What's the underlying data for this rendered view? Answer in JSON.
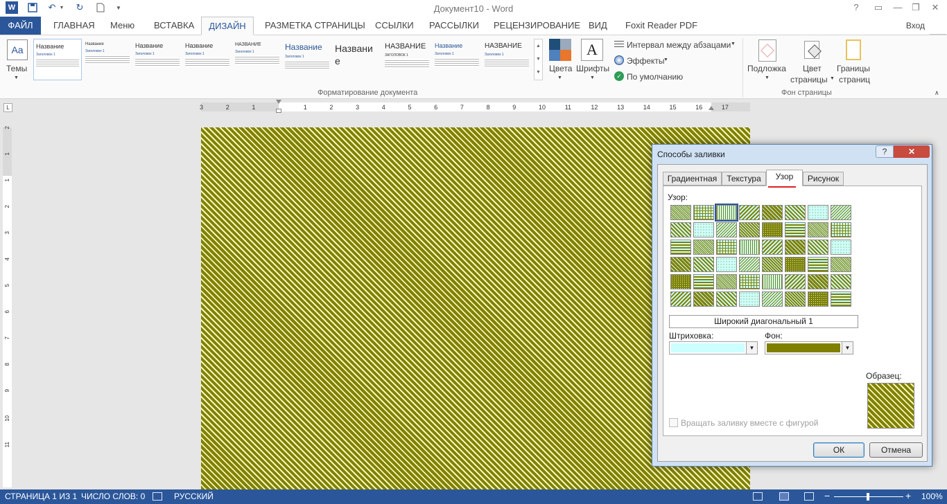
{
  "titlebar": {
    "title": "Документ10 - Word",
    "help": "?",
    "minimize": "—",
    "restore": "❐",
    "close": "✕"
  },
  "tabs": [
    {
      "label": "ФАЙЛ"
    },
    {
      "label": "ГЛАВНАЯ"
    },
    {
      "label": "Меню"
    },
    {
      "label": "ВСТАВКА"
    },
    {
      "label": "ДИЗАЙН"
    },
    {
      "label": "РАЗМЕТКА СТРАНИЦЫ"
    },
    {
      "label": "ССЫЛКИ"
    },
    {
      "label": "РАССЫЛКИ"
    },
    {
      "label": "РЕЦЕНЗИРОВАНИЕ"
    },
    {
      "label": "ВИД"
    },
    {
      "label": "Foxit Reader PDF"
    }
  ],
  "signin": "Вход",
  "ribbon": {
    "themes_label": "Темы",
    "themes_icon_text": "Aa",
    "gallery": [
      {
        "title": "Название",
        "sub": "Заголовок 1"
      },
      {
        "title": "Название",
        "sub": "Заголовок 1"
      },
      {
        "title": "Название",
        "sub": "Заголовок 1"
      },
      {
        "title": "Название",
        "sub": "Заголовок 1"
      },
      {
        "title": "НАЗВАНИЕ",
        "sub": "Заголовок 1"
      },
      {
        "title": "Название",
        "sub": "Заголовок 1"
      },
      {
        "title": "Названи е",
        "sub": ""
      },
      {
        "title": "НАЗВАНИЕ",
        "sub": "ЗАГОЛОВОК 1"
      },
      {
        "title": "Название",
        "sub": "Заголовок 1"
      },
      {
        "title": "НАЗВАНИЕ",
        "sub": "Заголовок 1"
      }
    ],
    "group_format_label": "Форматирование документа",
    "colors_label": "Цвета",
    "fonts_label": "Шрифты",
    "fonts_icon_text": "A",
    "paragraph_spacing_label": "Интервал между абзацами",
    "effects_label": "Эффекты",
    "default_label": "По умолчанию",
    "watermark_label": "Подложка",
    "page_color_label_1": "Цвет",
    "page_color_label_2": "страницы",
    "page_borders_label_1": "Границы",
    "page_borders_label_2": "страниц",
    "group_background_label": "Фон страницы"
  },
  "ruler": {
    "ticks": [
      "3",
      "2",
      "1",
      "1",
      "2",
      "3",
      "4",
      "5",
      "6",
      "7",
      "8",
      "9",
      "10",
      "11",
      "12",
      "13",
      "14",
      "15",
      "16",
      "17"
    ],
    "vticks": [
      "2",
      "1",
      "1",
      "2",
      "3",
      "4",
      "5",
      "6",
      "7",
      "8",
      "9",
      "10",
      "11"
    ]
  },
  "dialog": {
    "title": "Способы заливки",
    "help": "?",
    "close": "✕",
    "tabs": [
      {
        "label": "Градиентная"
      },
      {
        "label": "Текстура"
      },
      {
        "label": "Узор"
      },
      {
        "label": "Рисунок"
      }
    ],
    "pattern_label": "Узор:",
    "pattern_name": "Широкий диагональный 1",
    "foreground_label": "Штриховка:",
    "background_label": "Фон:",
    "foreground_color": "#ccffff",
    "background_color": "#808000",
    "sample_label": "Образец:",
    "rotate_label": "Вращать заливку вместе с фигурой",
    "ok_label": "ОК",
    "cancel_label": "Отмена",
    "dropdown_arrow": "▼"
  },
  "statusbar": {
    "page": "СТРАНИЦА 1 ИЗ 1",
    "words": "ЧИСЛО СЛОВ: 0",
    "language": "РУССКИЙ",
    "zoom_minus": "−",
    "zoom_plus": "+",
    "zoom": "100%"
  },
  "colors": {
    "accent": "#2b579a",
    "pattern_fg": "#808000",
    "pattern_bg": "#f5f7b8"
  }
}
